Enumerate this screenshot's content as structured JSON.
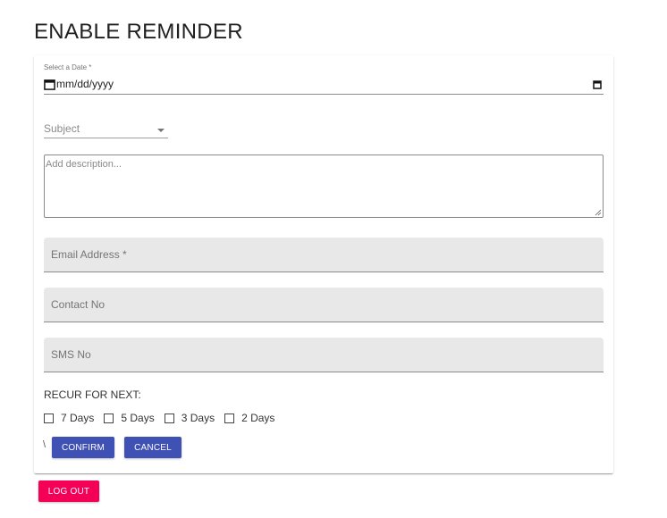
{
  "page": {
    "title": "ENABLE REMINDER"
  },
  "form": {
    "date": {
      "label": "Select a Date *",
      "placeholder": "mm/dd/yyyy"
    },
    "subject": {
      "label": "Subject",
      "icon": "arrow-drop-down-icon"
    },
    "description": {
      "placeholder": "Add description..."
    },
    "email": {
      "label": "Email Address *"
    },
    "contact": {
      "label": "Contact No"
    },
    "sms": {
      "label": "SMS No"
    },
    "recur": {
      "label": "RECUR FOR NEXT:",
      "options": [
        {
          "label": "7 Days",
          "checked": false
        },
        {
          "label": "5 Days",
          "checked": false
        },
        {
          "label": "3 Days",
          "checked": false
        },
        {
          "label": "2 Days",
          "checked": false
        }
      ]
    },
    "stray_text": "\\",
    "confirm_label": "CONFIRM",
    "cancel_label": "CANCEL"
  },
  "logout_label": "LOG OUT",
  "colors": {
    "primary": "#3f51b5",
    "secondary": "#f50057",
    "filled_bg": "#e8e8e8"
  }
}
